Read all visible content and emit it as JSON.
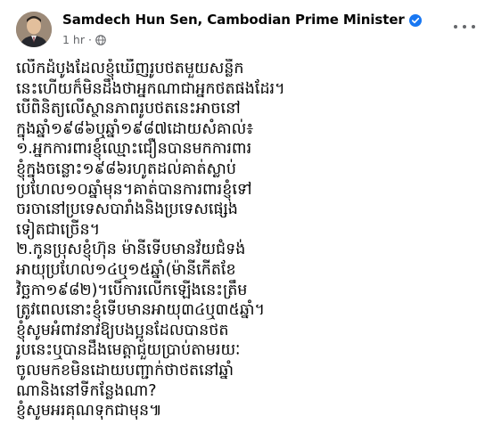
{
  "post": {
    "author": "Samdech Hun Sen, Cambodian Prime Minister",
    "time": "1 hr",
    "privacy_icon": "globe-icon",
    "verified_icon": "verified-badge-icon",
    "colors": {
      "verified": "#1877f2",
      "meta": "#65676b",
      "text": "#050505"
    },
    "lines": [
      "លើកដំបូងដែលខ្ញុំឃើញរូបថតមួយសន្លឹក",
      "នេះហើយក៏មិនដឹងថាអ្នកណាជាអ្នកថតផងដែរ។",
      "បើពិនិត្យលើស្ថានភាពរូបថតនេះអាចនៅ",
      "ក្នុងឆ្នាំ១៩៨៦ឬឆ្នាំ១៩៨៧ដោយសំគាល់៖",
      "១.អ្នកការពារខ្ញុំឈ្មោះជឿនបានមកការពារ",
      "ខ្ញុំក្នុងចន្លោះ១៩៨៦រហូតដល់គាត់ស្លាប់",
      "ប្រហែល១០ឆ្នាំមុន។គាត់បានការពារខ្ញុំទៅ",
      "ចរចានៅប្រទេសបារាំងនិងប្រទេសផ្សេង",
      "ទៀតជាច្រើន។",
      "២.កូនប្រុសខ្ញុំហ៊ុន ម៉ានីទើបមានវ័យជំទង់",
      "អាយុប្រហែល១៤ឬ១៥ឆ្នាំ(ម៉ានីកើតខែ",
      "វិច្ឆកា១៩៨២)។បើការលើកឡើងនេះត្រឹម",
      "ត្រូវពេលនោះខ្ញុំទើបមានអាយុ៣៤ឬ៣៥ឆ្នាំ។",
      "ខ្ញុំសូមអំពាវនាវឱ្យបងប្អូនដែលបានថត",
      "រូបនេះឬបានដឹងមេត្តាជួយប្រាប់តាមរយៈ",
      "ចូលមកខមិនដោយបញ្ជាក់ថាថតនៅឆ្នាំ",
      "ណានិងនៅទីកន្លែងណា?",
      "ខ្ញុំសូមអរគុណទុកជាមុន៕"
    ]
  }
}
